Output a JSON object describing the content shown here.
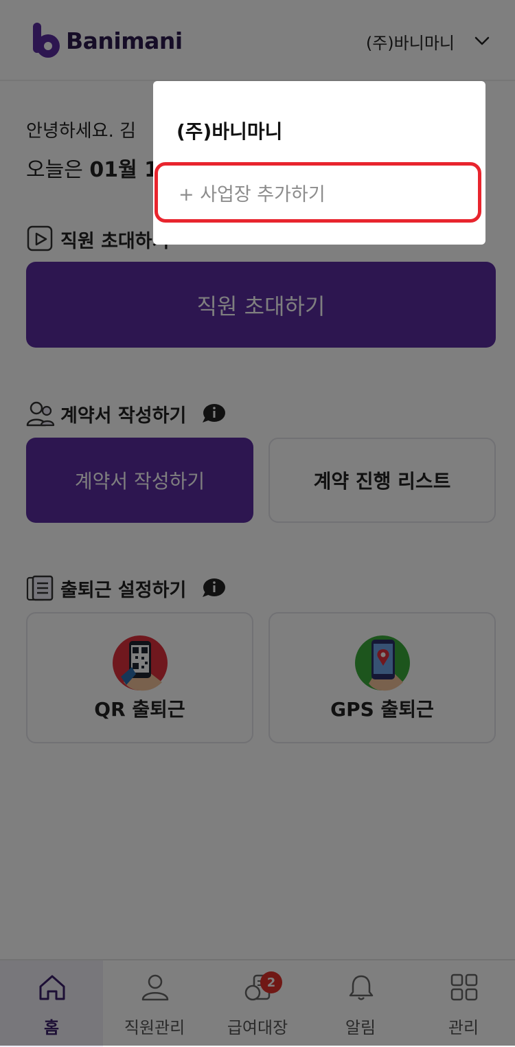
{
  "header": {
    "logo_text": "Banimani",
    "company": "(주)바니마니"
  },
  "greeting": {
    "line1": "안녕하세요. 김",
    "line2_prefix": "오늘은 ",
    "line2_bold": "01월 1"
  },
  "sections": {
    "invite": {
      "title": "직원 초대하기",
      "button": "직원 초대하기"
    },
    "contract": {
      "title": "계약서 작성하기",
      "primary_button": "계약서 작성하기",
      "secondary_button": "계약 진행 리스트"
    },
    "attendance": {
      "title": "출퇴근 설정하기",
      "qr_label": "QR 출퇴근",
      "gps_label": "GPS 출퇴근"
    }
  },
  "bottom_nav": {
    "items": [
      {
        "label": "홈",
        "icon": "home-icon"
      },
      {
        "label": "직원관리",
        "icon": "person-icon"
      },
      {
        "label": "급여대장",
        "icon": "coins-icon"
      },
      {
        "label": "알림",
        "icon": "bell-icon"
      },
      {
        "label": "관리",
        "icon": "grid-icon"
      }
    ],
    "active_index": 0,
    "notification_badge": "2"
  },
  "dropdown": {
    "items": [
      {
        "label": "(주)바니마니"
      },
      {
        "label": "+ 사업장 추가하기"
      }
    ],
    "highlighted_index": 1
  },
  "colors": {
    "brand": "#5a2ca0",
    "highlight": "#e8252e",
    "badge": "#e0312b"
  }
}
